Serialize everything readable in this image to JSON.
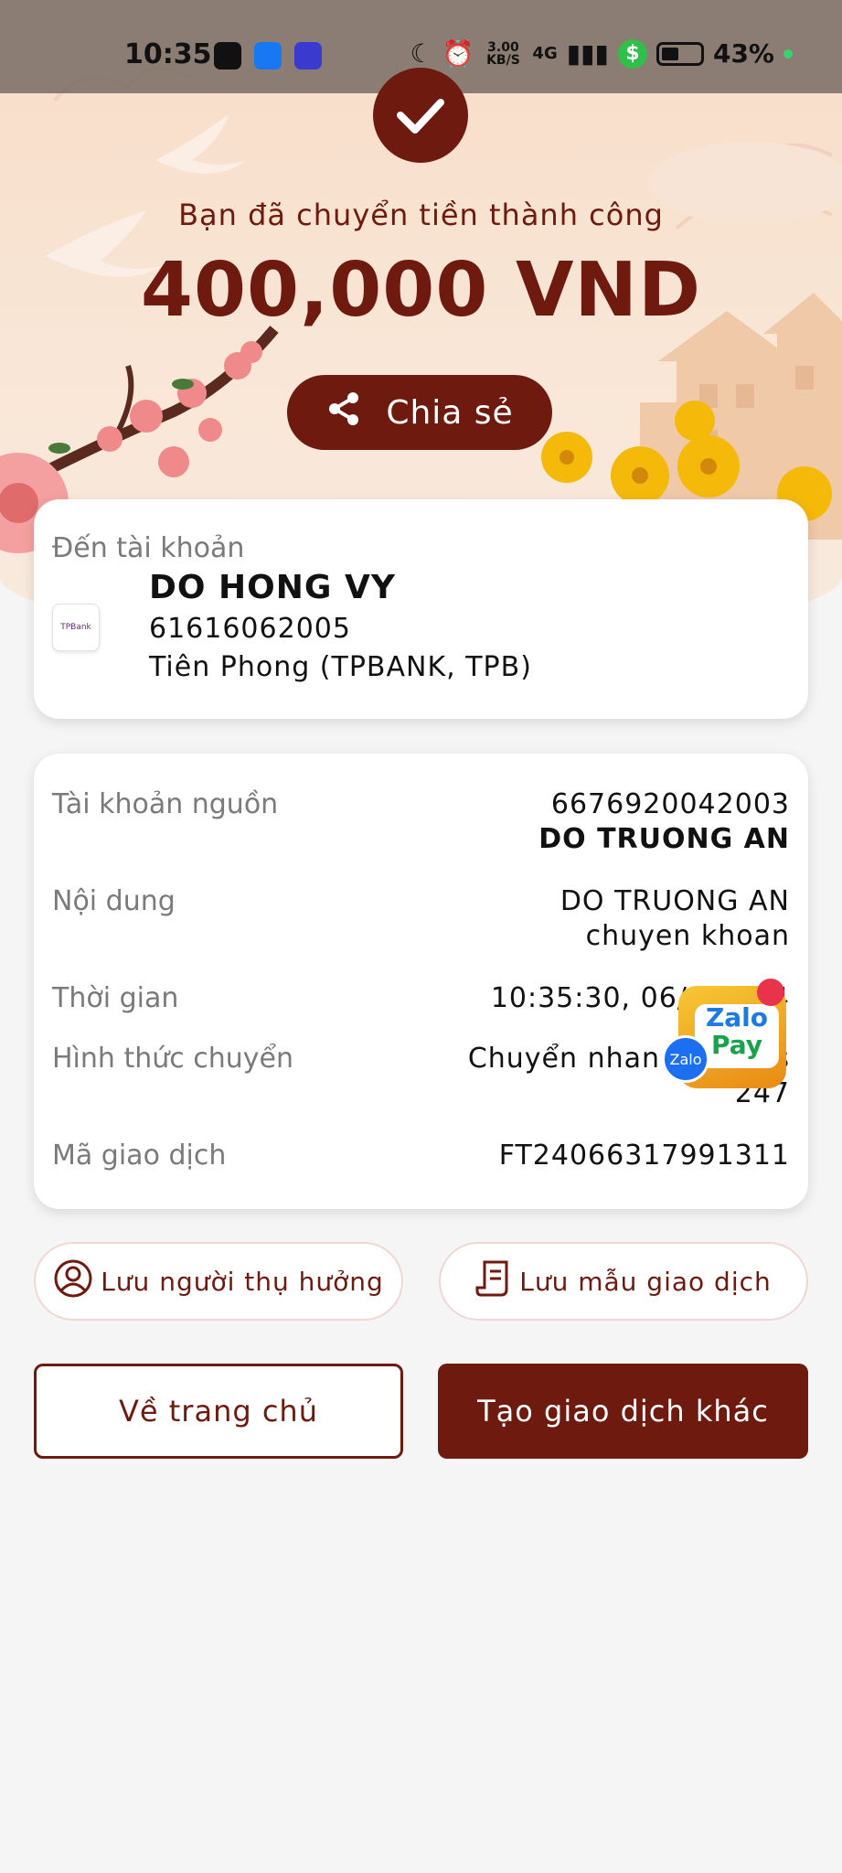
{
  "status_bar": {
    "time": "10:35",
    "network_speed": "3.00 KB/S",
    "network_type": "4G",
    "battery": "43%",
    "apps": [
      "zalo-icon",
      "messenger-icon",
      "game-icon"
    ]
  },
  "header": {
    "success_message": "Bạn đã chuyển tiền thành công",
    "amount": "400,000 VND",
    "share_label": "Chia sẻ"
  },
  "destination": {
    "label": "Đến tài khoản",
    "name": "DO HONG VY",
    "account_number": "61616062005",
    "bank": "Tiên Phong (TPBANK, TPB)",
    "bank_logo_text": "TPBank"
  },
  "details": {
    "source_label": "Tài khoản nguồn",
    "source_account": "6676920042003",
    "source_name": "DO TRUONG AN",
    "content_label": "Nội dung",
    "content_line1": "DO TRUONG AN",
    "content_line2": "chuyen khoan",
    "time_label": "Thời gian",
    "time_value": "10:35:30, 06/0",
    "time_value_tail": "4",
    "method_label": "Hình thức chuyển",
    "method_line1": "Chuyển nhan",
    "method_line1_tail": "s",
    "method_line2": "247",
    "txn_label": "Mã giao dịch",
    "txn_value": "FT24066317991311"
  },
  "floating_widget": {
    "line1": "Zalo",
    "line2": "Pay",
    "badge": "Zalo"
  },
  "actions": {
    "save_beneficiary": "Lưu người thụ hưởng",
    "save_template": "Lưu mẫu giao dịch",
    "go_home": "Về trang chủ",
    "new_transaction": "Tạo giao dịch khác"
  },
  "colors": {
    "brand": "#6e1a0f",
    "hero_bg": "#f7dcc7"
  }
}
